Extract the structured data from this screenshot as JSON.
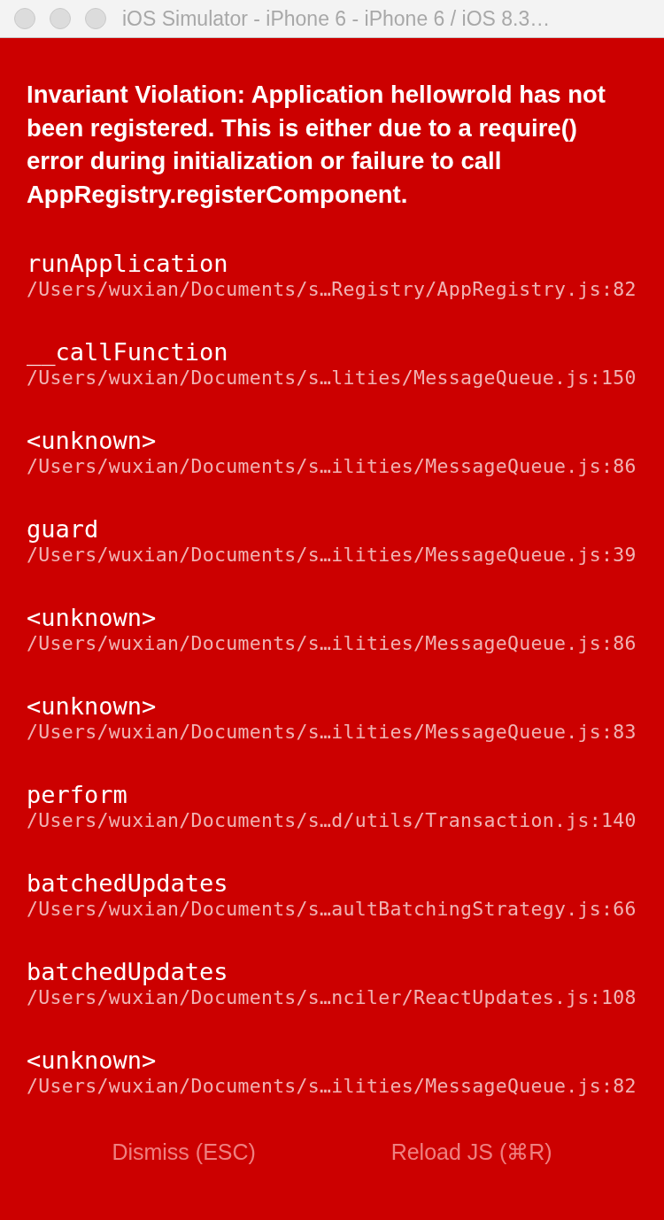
{
  "window": {
    "title": "iOS Simulator - iPhone 6 - iPhone 6 / iOS 8.3…"
  },
  "error": {
    "message": "Invariant Violation: Application hellowrold has not been registered. This is either due to a require() error during initialization or failure to call AppRegistry.registerComponent."
  },
  "stack": [
    {
      "method": "runApplication",
      "file": "/Users/wuxian/Documents/s…Registry/AppRegistry.js:82"
    },
    {
      "method": "__callFunction",
      "file": "/Users/wuxian/Documents/s…lities/MessageQueue.js:150"
    },
    {
      "method": "<unknown>",
      "file": "/Users/wuxian/Documents/s…ilities/MessageQueue.js:86"
    },
    {
      "method": "guard",
      "file": "/Users/wuxian/Documents/s…ilities/MessageQueue.js:39"
    },
    {
      "method": "<unknown>",
      "file": "/Users/wuxian/Documents/s…ilities/MessageQueue.js:86"
    },
    {
      "method": "<unknown>",
      "file": "/Users/wuxian/Documents/s…ilities/MessageQueue.js:83"
    },
    {
      "method": "perform",
      "file": "/Users/wuxian/Documents/s…d/utils/Transaction.js:140"
    },
    {
      "method": "batchedUpdates",
      "file": "/Users/wuxian/Documents/s…aultBatchingStrategy.js:66"
    },
    {
      "method": "batchedUpdates",
      "file": "/Users/wuxian/Documents/s…nciler/ReactUpdates.js:108"
    },
    {
      "method": "<unknown>",
      "file": "/Users/wuxian/Documents/s…ilities/MessageQueue.js:82"
    }
  ],
  "buttons": [
    "Dismiss (ESC)",
    "Reload JS (⌘R)"
  ]
}
